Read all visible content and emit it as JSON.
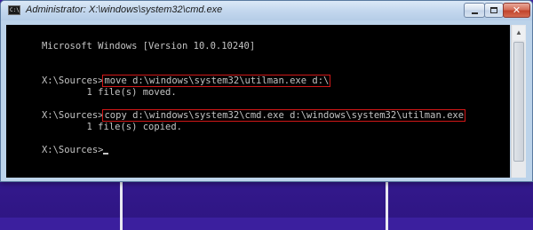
{
  "window": {
    "title": "Administrator: X:\\windows\\system32\\cmd.exe",
    "app_icon_text": "C:\\",
    "controls": {
      "minimize_icon": "minimize-icon",
      "maximize_icon": "maximize-icon",
      "close_icon": "close-icon",
      "close_glyph": "✕"
    }
  },
  "console": {
    "lines": {
      "banner": "Microsoft Windows [Version 10.0.10240]",
      "prompt1": "X:\\Sources>",
      "cmd1": "move d:\\windows\\system32\\utilman.exe d:\\",
      "out1": "        1 file(s) moved.",
      "prompt2": "X:\\Sources>",
      "cmd2": "copy d:\\windows\\system32\\cmd.exe d:\\windows\\system32\\utilman.exe",
      "out2": "        1 file(s) copied.",
      "prompt3": "X:\\Sources>"
    },
    "text_color": "#c4c4c4",
    "background": "#000000",
    "highlight_color": "#d11717"
  },
  "scrollbar": {
    "up_arrow": "▲"
  },
  "colors": {
    "desktop": "#3b1f9e",
    "titlebar": "#c4d8ee",
    "close_button": "#c2442c"
  }
}
